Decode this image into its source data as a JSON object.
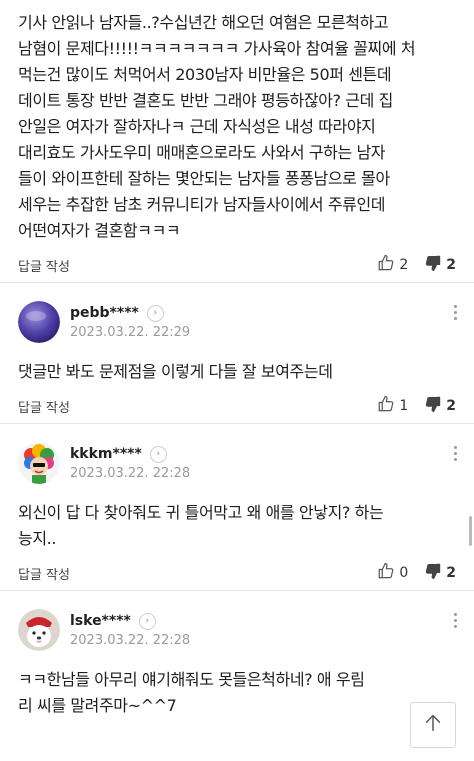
{
  "top_comment": {
    "text_lines": [
      "기사 안읽나 남자들..?수십년간 해오던 여혐은 모른척하고",
      "남혐이 문제다!!!!!ㅋㅋㅋㅋㅋㅋㅋ 가사육아 참여율 꼴찌에 처",
      "먹는건 많이도 처먹어서 2030남자 비만율은 50퍼 센튼데",
      "데이트 통장 반반 결혼도 반반 그래야 평등하잖아? 근데 집",
      "안일은 여자가 잘하자나ㅋ 근데 자식성은 내성 따라야지",
      "대리효도 가사도우미 매매혼으로라도 사와서 구하는 남자",
      "들이 와이프한테 잘하는 몇안되는 남자들 퐁퐁남으로 몰아",
      "세우는 추잡한 남초 커뮤니티가 남자들사이에서 주류인데",
      "어떤여자가 결혼함ㅋㅋㅋ"
    ],
    "reply_label": "답글 작성",
    "likes": "2",
    "dislikes": "2"
  },
  "comments": [
    {
      "username": "pebb****",
      "timestamp": "2023.03.22. 22:29",
      "text_lines": [
        "댓글만 봐도 문제점을 이렇게 다들 잘 보여주는데"
      ],
      "reply_label": "답글 작성",
      "likes": "1",
      "dislikes": "2"
    },
    {
      "username": "kkkm****",
      "timestamp": "2023.03.22. 22:28",
      "text_lines": [
        "외신이 답 다 찾아줘도 귀 틀어막고 왜 애를 안낳지? 하는",
        "능지.."
      ],
      "reply_label": "답글 작성",
      "likes": "0",
      "dislikes": "2"
    },
    {
      "username": "lske****",
      "timestamp": "2023.03.22. 22:28",
      "text_lines": [
        "ㅋㅋ한남들 아무리 얘기해줘도 못들은척하네? 애 우림",
        "리 씨를 말려주마~^^7"
      ]
    }
  ],
  "icons": {
    "like": "thumbs-up-icon",
    "dislike": "thumbs-down-icon",
    "scroll_top": "arrow-up-icon",
    "more": "more-vertical-icon",
    "profile": "chevron-right-icon"
  }
}
